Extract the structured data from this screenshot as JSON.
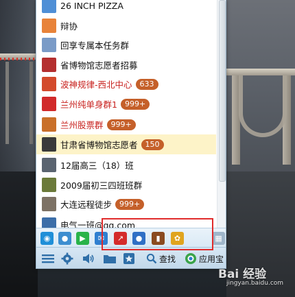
{
  "contacts": [
    {
      "name": "26 INCH PIZZA",
      "badge": "",
      "highlight": false,
      "red": false,
      "avatar_icon": "user-avatar-icon",
      "avatar_color": "#4f8fd6"
    },
    {
      "name": "辩协",
      "badge": "",
      "highlight": false,
      "red": false,
      "avatar_icon": "group-avatar-icon",
      "avatar_color": "#e8833a"
    },
    {
      "name": "回享专属本任务群",
      "badge": "",
      "highlight": false,
      "red": false,
      "avatar_icon": "group-avatar-icon",
      "avatar_color": "#7a9bc7"
    },
    {
      "name": "省博物馆志愿者招募",
      "badge": "",
      "highlight": false,
      "red": false,
      "avatar_icon": "group-avatar-icon",
      "avatar_color": "#b42f2f"
    },
    {
      "name": "波神规律-西北中心",
      "badge": "633",
      "highlight": false,
      "red": true,
      "avatar_icon": "group-avatar-icon",
      "avatar_color": "#d34a2c"
    },
    {
      "name": "兰州纯单身群1",
      "badge": "999+",
      "highlight": false,
      "red": true,
      "avatar_icon": "group-avatar-icon",
      "avatar_color": "#d12a2a"
    },
    {
      "name": "兰州股票群",
      "badge": "999+",
      "highlight": false,
      "red": true,
      "avatar_icon": "group-avatar-icon",
      "avatar_color": "#c9702a"
    },
    {
      "name": "甘肃省博物馆志愿者",
      "badge": "150",
      "highlight": true,
      "red": false,
      "avatar_icon": "group-avatar-icon",
      "avatar_color": "#3a3a3a"
    },
    {
      "name": "12届高三（18）班",
      "badge": "",
      "highlight": false,
      "red": false,
      "avatar_icon": "group-avatar-icon",
      "avatar_color": "#5a6470"
    },
    {
      "name": "2009届初三四班班群",
      "badge": "",
      "highlight": false,
      "red": false,
      "avatar_icon": "group-avatar-icon",
      "avatar_color": "#6b7a3a"
    },
    {
      "name": "大连远程徒步",
      "badge": "999+",
      "highlight": false,
      "red": false,
      "avatar_icon": "group-avatar-icon",
      "avatar_color": "#7d7265"
    },
    {
      "name": "电气一班@qq.com",
      "badge": "",
      "highlight": false,
      "red": false,
      "avatar_icon": "group-avatar-icon",
      "avatar_color": "#3c6ea8"
    }
  ],
  "apps": [
    {
      "icon": "qzone-icon",
      "color": "#1f8fd8",
      "glyph": "◉"
    },
    {
      "icon": "qq-video-icon",
      "color": "#3d8ed0",
      "glyph": "●"
    },
    {
      "icon": "play-icon",
      "color": "#29b34a",
      "glyph": "▶"
    },
    {
      "icon": "mail-icon",
      "color": "#2f7fd0",
      "glyph": "✉"
    },
    {
      "icon": "stock-chart-icon",
      "color": "#d42b2b",
      "glyph": "↗"
    },
    {
      "icon": "microphone-icon",
      "color": "#2f6fc5",
      "glyph": "●"
    },
    {
      "icon": "book-icon",
      "color": "#8a4a1f",
      "glyph": "▮"
    },
    {
      "icon": "pet-icon",
      "color": "#e0a41e",
      "glyph": "✿"
    },
    {
      "icon": "more-apps-grid-icon",
      "color": "#9fb6ca",
      "glyph": "▦"
    }
  ],
  "toolbar": {
    "menu_icon": "menu-icon",
    "settings_icon": "gear-icon",
    "volume_icon": "speaker-icon",
    "folder_icon": "folder-icon",
    "favorite_icon": "bookmark-icon",
    "search_label": "查找",
    "app_store_label": "应用宝"
  },
  "watermark": {
    "text": "Bai 经验",
    "url": "jingyan.baidu.com"
  }
}
